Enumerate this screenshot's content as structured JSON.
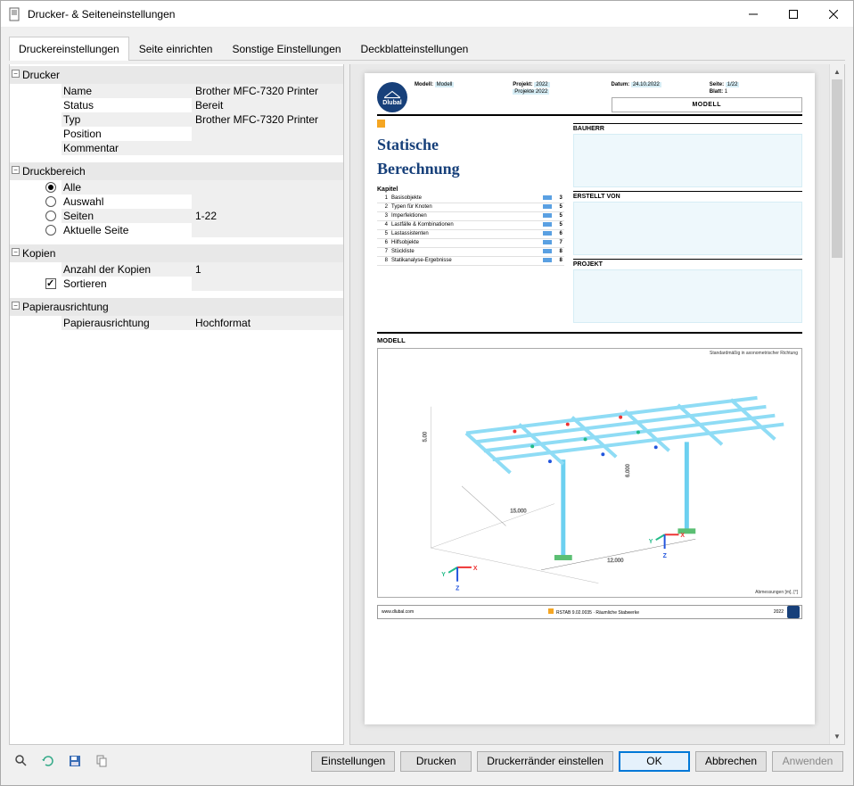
{
  "window": {
    "title": "Drucker- & Seiteneinstellungen"
  },
  "tabs": [
    "Druckereinstellungen",
    "Seite einrichten",
    "Sonstige Einstellungen",
    "Deckblatteinstellungen"
  ],
  "active_tab": 0,
  "groups": {
    "drucker": {
      "title": "Drucker",
      "rows": [
        {
          "label": "Name",
          "value": "Brother MFC-7320 Printer"
        },
        {
          "label": "Status",
          "value": "Bereit"
        },
        {
          "label": "Typ",
          "value": "Brother MFC-7320 Printer"
        },
        {
          "label": "Position",
          "value": ""
        },
        {
          "label": "Kommentar",
          "value": ""
        }
      ]
    },
    "druckbereich": {
      "title": "Druckbereich",
      "options": [
        {
          "label": "Alle",
          "checked": true,
          "value": ""
        },
        {
          "label": "Auswahl",
          "checked": false,
          "value": ""
        },
        {
          "label": "Seiten",
          "checked": false,
          "value": "1-22"
        },
        {
          "label": "Aktuelle Seite",
          "checked": false,
          "value": ""
        }
      ]
    },
    "kopien": {
      "title": "Kopien",
      "rows": [
        {
          "label": "Anzahl der Kopien",
          "value": "1",
          "type": "text"
        },
        {
          "label": "Sortieren",
          "value": "",
          "type": "check",
          "checked": true
        }
      ]
    },
    "papier": {
      "title": "Papierausrichtung",
      "rows": [
        {
          "label": "Papierausrichtung",
          "value": "Hochformat"
        }
      ]
    }
  },
  "preview": {
    "logo_text": "Dlubal",
    "header": {
      "model_k": "Modell:",
      "model_v": "Modell",
      "project_k": "Projekt:",
      "project_v": "2022",
      "project2_v": "Projekte 2022",
      "date_k": "Datum:",
      "date_v": "24.10.2022",
      "page_k": "Seite:",
      "page_v": "1/22",
      "sheet_k": "Blatt:",
      "sheet_v": "1",
      "model_box": "MODELL"
    },
    "title1": "Statische",
    "title2": "Berechnung",
    "bauherr": "BAUHERR",
    "erstellt": "ERSTELLT VON",
    "projekt": "PROJEKT",
    "kapitel": "Kapitel",
    "toc": [
      {
        "n": "1",
        "t": "Basisobjekte",
        "p": "3"
      },
      {
        "n": "2",
        "t": "Typen für Knoten",
        "p": "5"
      },
      {
        "n": "3",
        "t": "Imperfektionen",
        "p": "5"
      },
      {
        "n": "4",
        "t": "Lastfälle & Kombinationen",
        "p": "5"
      },
      {
        "n": "5",
        "t": "Lastassistenten",
        "p": "6"
      },
      {
        "n": "6",
        "t": "Hilfsobjekte",
        "p": "7"
      },
      {
        "n": "7",
        "t": "Stückliste",
        "p": "8"
      },
      {
        "n": "8",
        "t": "Statikanalyse-Ergebnisse",
        "p": "8"
      }
    ],
    "model_header": "MODELL",
    "model_note": "Standardmäßig in axonometrischer Richtung",
    "model_unit": "Abmessungen [m], [°]",
    "footer": {
      "url": "www.dlubal.com",
      "prog": "RSTAB 9.02.0035 · Räumliche Stabwerke",
      "year": "2022"
    }
  },
  "buttons": {
    "settings": "Einstellungen",
    "print": "Drucken",
    "margins": "Druckerränder einstellen",
    "ok": "OK",
    "cancel": "Abbrechen",
    "apply": "Anwenden"
  }
}
